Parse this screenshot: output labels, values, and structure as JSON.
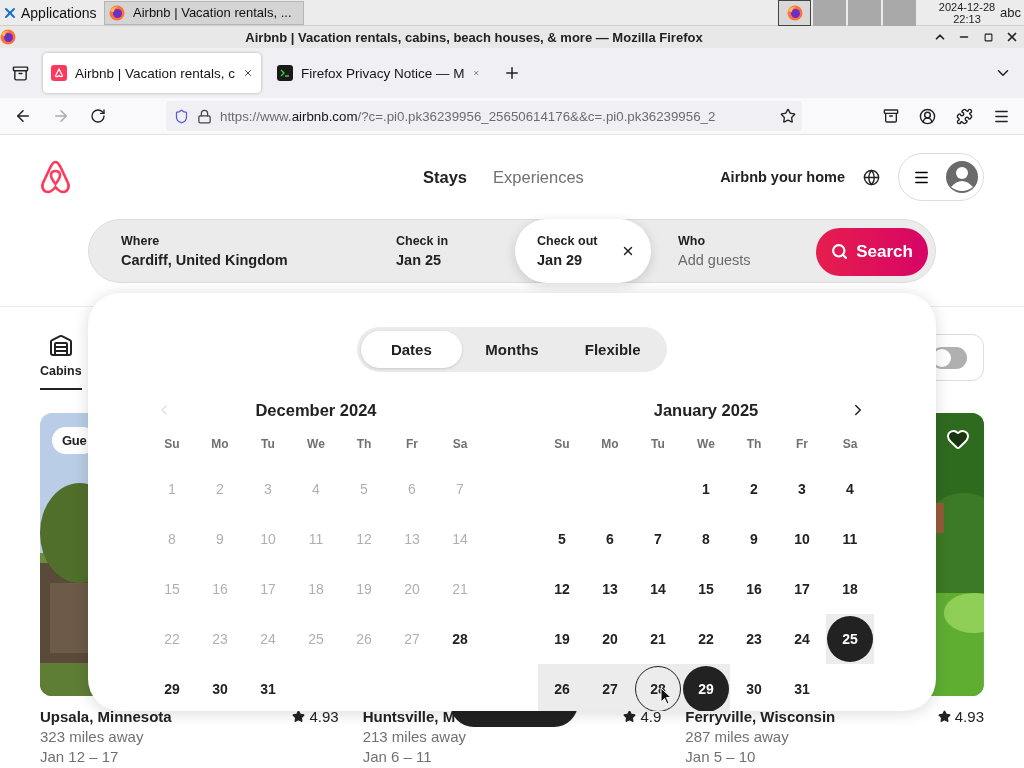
{
  "taskbar": {
    "apps_label": "Applications",
    "window_button": "Airbnb | Vacation rentals, ...",
    "date": "2024-12-28",
    "time": "22:13",
    "keyboard": "abc"
  },
  "browser": {
    "title": "Airbnb | Vacation rentals, cabins, beach houses, & more — Mozilla Firefox",
    "tabs": [
      {
        "title": "Airbnb | Vacation rentals, c",
        "selected": true
      },
      {
        "title": "Firefox Privacy Notice — M",
        "selected": false
      }
    ],
    "url": {
      "scheme": "https://www.",
      "domain": "airbnb.com",
      "path": "/?c=.pi0.pk36239956_25650614176&&c=.pi0.pk36239956_2"
    }
  },
  "header": {
    "nav": [
      {
        "label": "Stays",
        "selected": true
      },
      {
        "label": "Experiences",
        "selected": false
      }
    ],
    "host_link": "Airbnb your home"
  },
  "search": {
    "fields": [
      {
        "label": "Where",
        "value": "Cardiff, United Kingdom",
        "selected": false
      },
      {
        "label": "Check in",
        "value": "Jan 25",
        "selected": false
      },
      {
        "label": "Check out",
        "value": "Jan 29",
        "selected": true
      },
      {
        "label": "Who",
        "placeholder": "Add guests",
        "selected": false
      }
    ],
    "button": "Search"
  },
  "category": {
    "label": "Cabins",
    "selected": true
  },
  "price_toggle": {
    "on": false
  },
  "picker": {
    "modes": [
      {
        "label": "Dates",
        "selected": true
      },
      {
        "label": "Months",
        "selected": false
      },
      {
        "label": "Flexible",
        "selected": false
      }
    ],
    "prev_month": {
      "disabled": true
    },
    "next_month": {
      "disabled": false
    },
    "months": [
      {
        "title": "December 2024",
        "weekdays": [
          "Su",
          "Mo",
          "Tu",
          "We",
          "Th",
          "Fr",
          "Sa"
        ],
        "days": [
          {
            "kind": "day",
            "d": "1",
            "disabled": true,
            "selected": false,
            "in_range": false,
            "hovered": false
          },
          {
            "kind": "day",
            "d": "2",
            "disabled": true,
            "selected": false,
            "in_range": false,
            "hovered": false
          },
          {
            "kind": "day",
            "d": "3",
            "disabled": true,
            "selected": false,
            "in_range": false,
            "hovered": false
          },
          {
            "kind": "day",
            "d": "4",
            "disabled": true,
            "selected": false,
            "in_range": false,
            "hovered": false
          },
          {
            "kind": "day",
            "d": "5",
            "disabled": true,
            "selected": false,
            "in_range": false,
            "hovered": false
          },
          {
            "kind": "day",
            "d": "6",
            "disabled": true,
            "selected": false,
            "in_range": false,
            "hovered": false
          },
          {
            "kind": "day",
            "d": "7",
            "disabled": true,
            "selected": false,
            "in_range": false,
            "hovered": false
          },
          {
            "kind": "day",
            "d": "8",
            "disabled": true,
            "selected": false,
            "in_range": false,
            "hovered": false
          },
          {
            "kind": "day",
            "d": "9",
            "disabled": true,
            "selected": false,
            "in_range": false,
            "hovered": false
          },
          {
            "kind": "day",
            "d": "10",
            "disabled": true,
            "selected": false,
            "in_range": false,
            "hovered": false
          },
          {
            "kind": "day",
            "d": "11",
            "disabled": true,
            "selected": false,
            "in_range": false,
            "hovered": false
          },
          {
            "kind": "day",
            "d": "12",
            "disabled": true,
            "selected": false,
            "in_range": false,
            "hovered": false
          },
          {
            "kind": "day",
            "d": "13",
            "disabled": true,
            "selected": false,
            "in_range": false,
            "hovered": false
          },
          {
            "kind": "day",
            "d": "14",
            "disabled": true,
            "selected": false,
            "in_range": false,
            "hovered": false
          },
          {
            "kind": "day",
            "d": "15",
            "disabled": true,
            "selected": false,
            "in_range": false,
            "hovered": false
          },
          {
            "kind": "day",
            "d": "16",
            "disabled": true,
            "selected": false,
            "in_range": false,
            "hovered": false
          },
          {
            "kind": "day",
            "d": "17",
            "disabled": true,
            "selected": false,
            "in_range": false,
            "hovered": false
          },
          {
            "kind": "day",
            "d": "18",
            "disabled": true,
            "selected": false,
            "in_range": false,
            "hovered": false
          },
          {
            "kind": "day",
            "d": "19",
            "disabled": true,
            "selected": false,
            "in_range": false,
            "hovered": false
          },
          {
            "kind": "day",
            "d": "20",
            "disabled": true,
            "selected": false,
            "in_range": false,
            "hovered": false
          },
          {
            "kind": "day",
            "d": "21",
            "disabled": true,
            "selected": false,
            "in_range": false,
            "hovered": false
          },
          {
            "kind": "day",
            "d": "22",
            "disabled": true,
            "selected": false,
            "in_range": false,
            "hovered": false
          },
          {
            "kind": "day",
            "d": "23",
            "disabled": true,
            "selected": false,
            "in_range": false,
            "hovered": false
          },
          {
            "kind": "day",
            "d": "24",
            "disabled": true,
            "selected": false,
            "in_range": false,
            "hovered": false
          },
          {
            "kind": "day",
            "d": "25",
            "disabled": true,
            "selected": false,
            "in_range": false,
            "hovered": false
          },
          {
            "kind": "day",
            "d": "26",
            "disabled": true,
            "selected": false,
            "in_range": false,
            "hovered": false
          },
          {
            "kind": "day",
            "d": "27",
            "disabled": true,
            "selected": false,
            "in_range": false,
            "hovered": false
          },
          {
            "kind": "day",
            "d": "28",
            "disabled": false,
            "selected": false,
            "in_range": false,
            "hovered": false
          },
          {
            "kind": "day",
            "d": "29",
            "disabled": false,
            "selected": false,
            "in_range": false,
            "hovered": false
          },
          {
            "kind": "day",
            "d": "30",
            "disabled": false,
            "selected": false,
            "in_range": false,
            "hovered": false
          },
          {
            "kind": "day",
            "d": "31",
            "disabled": false,
            "selected": false,
            "in_range": false,
            "hovered": false
          }
        ]
      },
      {
        "title": "January 2025",
        "weekdays": [
          "Su",
          "Mo",
          "Tu",
          "We",
          "Th",
          "Fr",
          "Sa"
        ],
        "days": [
          {
            "kind": "blank"
          },
          {
            "kind": "blank"
          },
          {
            "kind": "blank"
          },
          {
            "kind": "day",
            "d": "1",
            "disabled": false,
            "selected": false,
            "in_range": false,
            "hovered": false
          },
          {
            "kind": "day",
            "d": "2",
            "disabled": false,
            "selected": false,
            "in_range": false,
            "hovered": false
          },
          {
            "kind": "day",
            "d": "3",
            "disabled": false,
            "selected": false,
            "in_range": false,
            "hovered": false
          },
          {
            "kind": "day",
            "d": "4",
            "disabled": false,
            "selected": false,
            "in_range": false,
            "hovered": false
          },
          {
            "kind": "day",
            "d": "5",
            "disabled": false,
            "selected": false,
            "in_range": false,
            "hovered": false
          },
          {
            "kind": "day",
            "d": "6",
            "disabled": false,
            "selected": false,
            "in_range": false,
            "hovered": false
          },
          {
            "kind": "day",
            "d": "7",
            "disabled": false,
            "selected": false,
            "in_range": false,
            "hovered": false
          },
          {
            "kind": "day",
            "d": "8",
            "disabled": false,
            "selected": false,
            "in_range": false,
            "hovered": false
          },
          {
            "kind": "day",
            "d": "9",
            "disabled": false,
            "selected": false,
            "in_range": false,
            "hovered": false
          },
          {
            "kind": "day",
            "d": "10",
            "disabled": false,
            "selected": false,
            "in_range": false,
            "hovered": false
          },
          {
            "kind": "day",
            "d": "11",
            "disabled": false,
            "selected": false,
            "in_range": false,
            "hovered": false
          },
          {
            "kind": "day",
            "d": "12",
            "disabled": false,
            "selected": false,
            "in_range": false,
            "hovered": false
          },
          {
            "kind": "day",
            "d": "13",
            "disabled": false,
            "selected": false,
            "in_range": false,
            "hovered": false
          },
          {
            "kind": "day",
            "d": "14",
            "disabled": false,
            "selected": false,
            "in_range": false,
            "hovered": false
          },
          {
            "kind": "day",
            "d": "15",
            "disabled": false,
            "selected": false,
            "in_range": false,
            "hovered": false
          },
          {
            "kind": "day",
            "d": "16",
            "disabled": false,
            "selected": false,
            "in_range": false,
            "hovered": false
          },
          {
            "kind": "day",
            "d": "17",
            "disabled": false,
            "selected": false,
            "in_range": false,
            "hovered": false
          },
          {
            "kind": "day",
            "d": "18",
            "disabled": false,
            "selected": false,
            "in_range": false,
            "hovered": false
          },
          {
            "kind": "day",
            "d": "19",
            "disabled": false,
            "selected": false,
            "in_range": false,
            "hovered": false
          },
          {
            "kind": "day",
            "d": "20",
            "disabled": false,
            "selected": false,
            "in_range": false,
            "hovered": false
          },
          {
            "kind": "day",
            "d": "21",
            "disabled": false,
            "selected": false,
            "in_range": false,
            "hovered": false
          },
          {
            "kind": "day",
            "d": "22",
            "disabled": false,
            "selected": false,
            "in_range": false,
            "hovered": false
          },
          {
            "kind": "day",
            "d": "23",
            "disabled": false,
            "selected": false,
            "in_range": false,
            "hovered": false
          },
          {
            "kind": "day",
            "d": "24",
            "disabled": false,
            "selected": false,
            "in_range": false,
            "hovered": false
          },
          {
            "kind": "day",
            "d": "25",
            "disabled": false,
            "selected": true,
            "in_range": true,
            "hovered": false
          },
          {
            "kind": "day",
            "d": "26",
            "disabled": false,
            "selected": false,
            "in_range": true,
            "hovered": false
          },
          {
            "kind": "day",
            "d": "27",
            "disabled": false,
            "selected": false,
            "in_range": true,
            "hovered": false
          },
          {
            "kind": "day",
            "d": "28",
            "disabled": false,
            "selected": false,
            "in_range": true,
            "hovered": true
          },
          {
            "kind": "day",
            "d": "29",
            "disabled": false,
            "selected": true,
            "in_range": true,
            "hovered": false
          },
          {
            "kind": "day",
            "d": "30",
            "disabled": false,
            "selected": false,
            "in_range": false,
            "hovered": false
          },
          {
            "kind": "day",
            "d": "31",
            "disabled": false,
            "selected": false,
            "in_range": false,
            "hovered": false
          }
        ]
      }
    ]
  },
  "listings": [
    {
      "title": "Upsala, Minnesota",
      "rating": "4.93",
      "distance": "323 miles away",
      "dates": "Jan 12 – 17",
      "badge": "Gue"
    },
    {
      "title": "Huntsville, M",
      "rating": "4.9",
      "distance": "213 miles away",
      "dates": "Jan 6 – 11"
    },
    {
      "title": "Ferryville, Wisconsin",
      "rating": "4.93",
      "distance": "287 miles away",
      "dates": "Jan 5 – 10",
      "heart": {
        "selected": false
      }
    }
  ]
}
